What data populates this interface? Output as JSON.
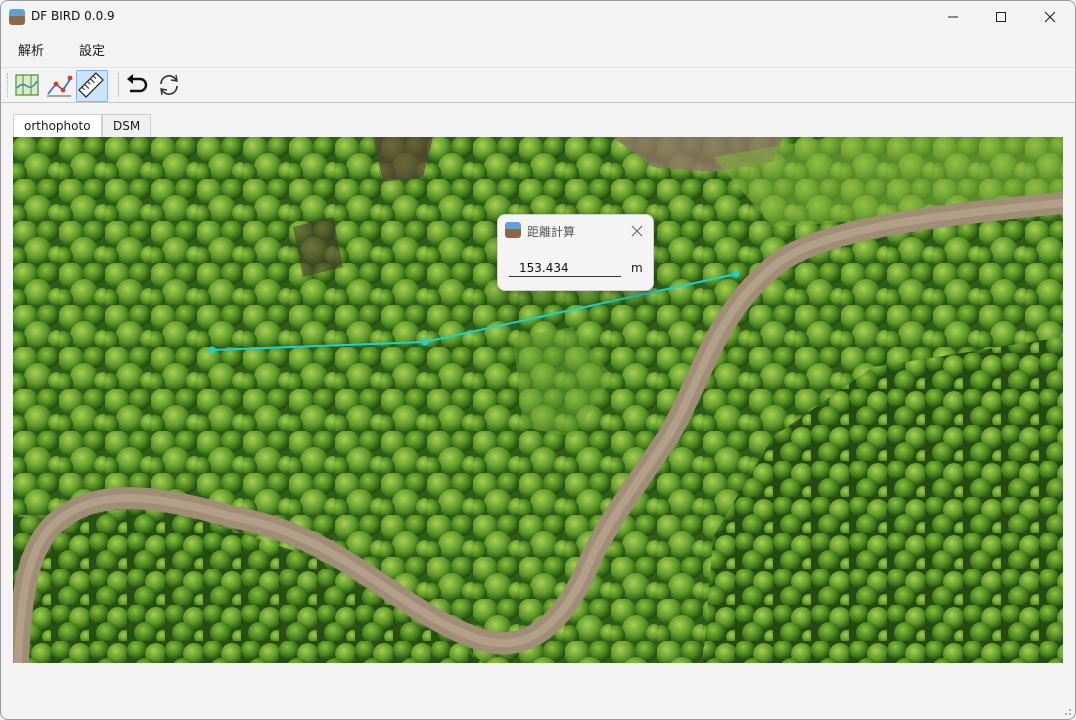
{
  "window": {
    "title": "DF BIRD 0.0.9",
    "minimize": "─",
    "maximize": "☐",
    "close": "✕"
  },
  "menu": [
    {
      "label": "解析"
    },
    {
      "label": "設定"
    }
  ],
  "toolbar": [
    {
      "name": "map-tool-icon"
    },
    {
      "name": "point-analysis-icon"
    },
    {
      "name": "ruler-icon",
      "active": true
    },
    {
      "name": "undo-icon"
    },
    {
      "name": "refresh-icon"
    }
  ],
  "tabs": [
    {
      "label": "orthophoto",
      "active": true
    },
    {
      "label": "DSM"
    }
  ],
  "dialog": {
    "title": "距離計算",
    "close": "✕",
    "distance_value": "153.434",
    "unit": "m"
  },
  "colors": {
    "measure_line": "#19d3d3",
    "forest": "#3e7a1e",
    "road": "#9b8a74",
    "accent": "#7eb4ea"
  }
}
